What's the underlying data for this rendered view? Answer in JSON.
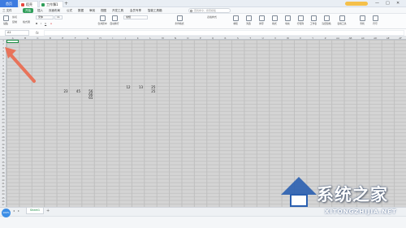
{
  "title_bar": {
    "home_tab": "首页",
    "tabs": [
      {
        "label": "稻壳",
        "icon": "docer-icon",
        "color": "#e8473f"
      },
      {
        "label": "工作簿1",
        "icon": "sheet-file-icon",
        "color": "#2f9e5a"
      }
    ],
    "new_tab": "+",
    "user_label": "",
    "window_controls": [
      "—",
      "□",
      "✕"
    ]
  },
  "menu": {
    "items": [
      "三 文件",
      "开始",
      "插入",
      "页面布局",
      "公式",
      "数据",
      "审阅",
      "视图",
      "开发工具",
      "会员专享",
      "智能工具箱"
    ],
    "active_index": 1,
    "search_placeholder": "查找命令、搜索模板"
  },
  "ribbon": {
    "font_name": "宋体",
    "font_size": "11",
    "buttons": [
      "粘贴",
      "剪切",
      "复制",
      "格式刷",
      "合并居中",
      "自动换行",
      "常规",
      "条件格式",
      "表格样式",
      "求和",
      "筛选",
      "排序",
      "格式",
      "填充",
      "行和列",
      "工作表",
      "冻结窗格",
      "表格工具",
      "查找",
      "符号"
    ]
  },
  "formula_bar": {
    "name_box": "A1",
    "fx": "fx",
    "value": ""
  },
  "grid": {
    "columns": [
      "A",
      "B",
      "C",
      "D",
      "E",
      "F",
      "G",
      "H",
      "I",
      "J",
      "K",
      "L",
      "M",
      "N",
      "O",
      "P",
      "Q",
      "R",
      "S",
      "T",
      "U",
      "V",
      "W",
      "X",
      "Y",
      "Z",
      "AA",
      "AB",
      "AC",
      "AD",
      "AE",
      "AF"
    ],
    "rows": [
      "1",
      "2",
      "3",
      "4",
      "5",
      "6",
      "7",
      "8",
      "9",
      "10",
      "11",
      "12",
      "13",
      "14",
      "15",
      "16",
      "17",
      "18",
      "19",
      "20",
      "21",
      "22",
      "23",
      "24",
      "25",
      "26",
      "27",
      "28",
      "29",
      "30",
      "31",
      "32",
      "33",
      "34",
      "35",
      "36",
      "37",
      "38",
      "39",
      "40",
      "41",
      "42",
      "43",
      "44",
      "45",
      "46",
      "47"
    ],
    "cells": [
      {
        "text": "23",
        "col": 4,
        "row": 15
      },
      {
        "text": "45",
        "col": 5,
        "row": 15
      },
      {
        "text": "56",
        "col": 6,
        "row": 15
      },
      {
        "text": "66",
        "col": 6,
        "row": 16
      },
      {
        "text": "65",
        "col": 6,
        "row": 17
      },
      {
        "text": "12",
        "col": 9,
        "row": 14
      },
      {
        "text": "13",
        "col": 10,
        "row": 14
      },
      {
        "text": "25",
        "col": 11,
        "row": 14
      },
      {
        "text": "25",
        "col": 11,
        "row": 15
      }
    ]
  },
  "sheet_bar": {
    "sheet_name": "Sheet1",
    "add": "+"
  },
  "status_bar": {
    "zoom_badge": "100%",
    "text": "",
    "zoom": ""
  },
  "watermark": {
    "brand": "系统之家",
    "url": "XITONGZHIJIA.NET"
  },
  "colors": {
    "accent_green": "#2f9e5a",
    "annotation_arrow": "#e8735a",
    "brand_blue": "#3d7be0"
  }
}
